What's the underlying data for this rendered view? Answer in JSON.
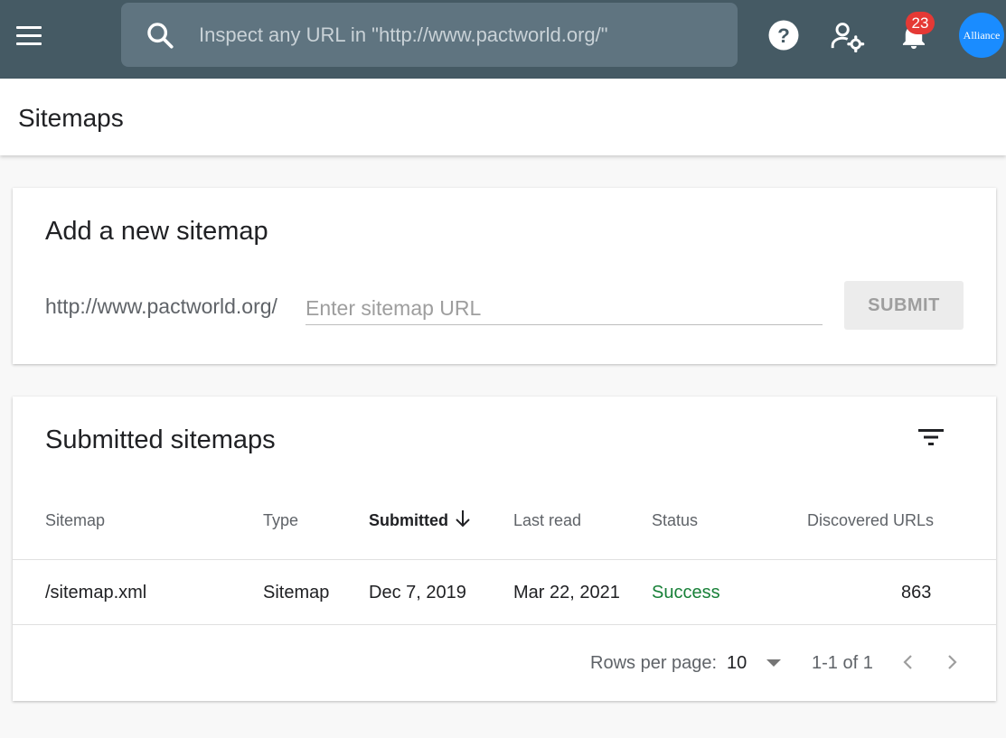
{
  "header": {
    "search_placeholder": "Inspect any URL in \"http://www.pactworld.org/\"",
    "notification_count": "23",
    "avatar_text": "Alliance",
    "icons": [
      "menu-icon",
      "search-icon",
      "help-icon",
      "admin-settings-icon",
      "bell-icon"
    ]
  },
  "page": {
    "title": "Sitemaps"
  },
  "add_sitemap": {
    "title": "Add a new sitemap",
    "prefix": "http://www.pactworld.org/",
    "input_placeholder": "Enter sitemap URL",
    "submit_label": "SUBMIT"
  },
  "submitted": {
    "title": "Submitted sitemaps",
    "columns": [
      "Sitemap",
      "Type",
      "Submitted",
      "Last read",
      "Status",
      "Discovered URLs"
    ],
    "sorted_column": "Submitted",
    "sort_direction": "descending",
    "rows": [
      {
        "sitemap": "/sitemap.xml",
        "type": "Sitemap",
        "submitted": "Dec 7, 2019",
        "last_read": "Mar 22, 2021",
        "status": "Success",
        "discovered_urls": "863"
      }
    ],
    "footer": {
      "rows_per_page_label": "Rows per page:",
      "rows_per_page": "10",
      "range": "1-1 of 1"
    }
  },
  "colors": {
    "topbar": "#455a64",
    "search_bg": "#5f7480",
    "status_success": "#188038",
    "badge": "#e53935",
    "avatar": "#1a8cff"
  }
}
